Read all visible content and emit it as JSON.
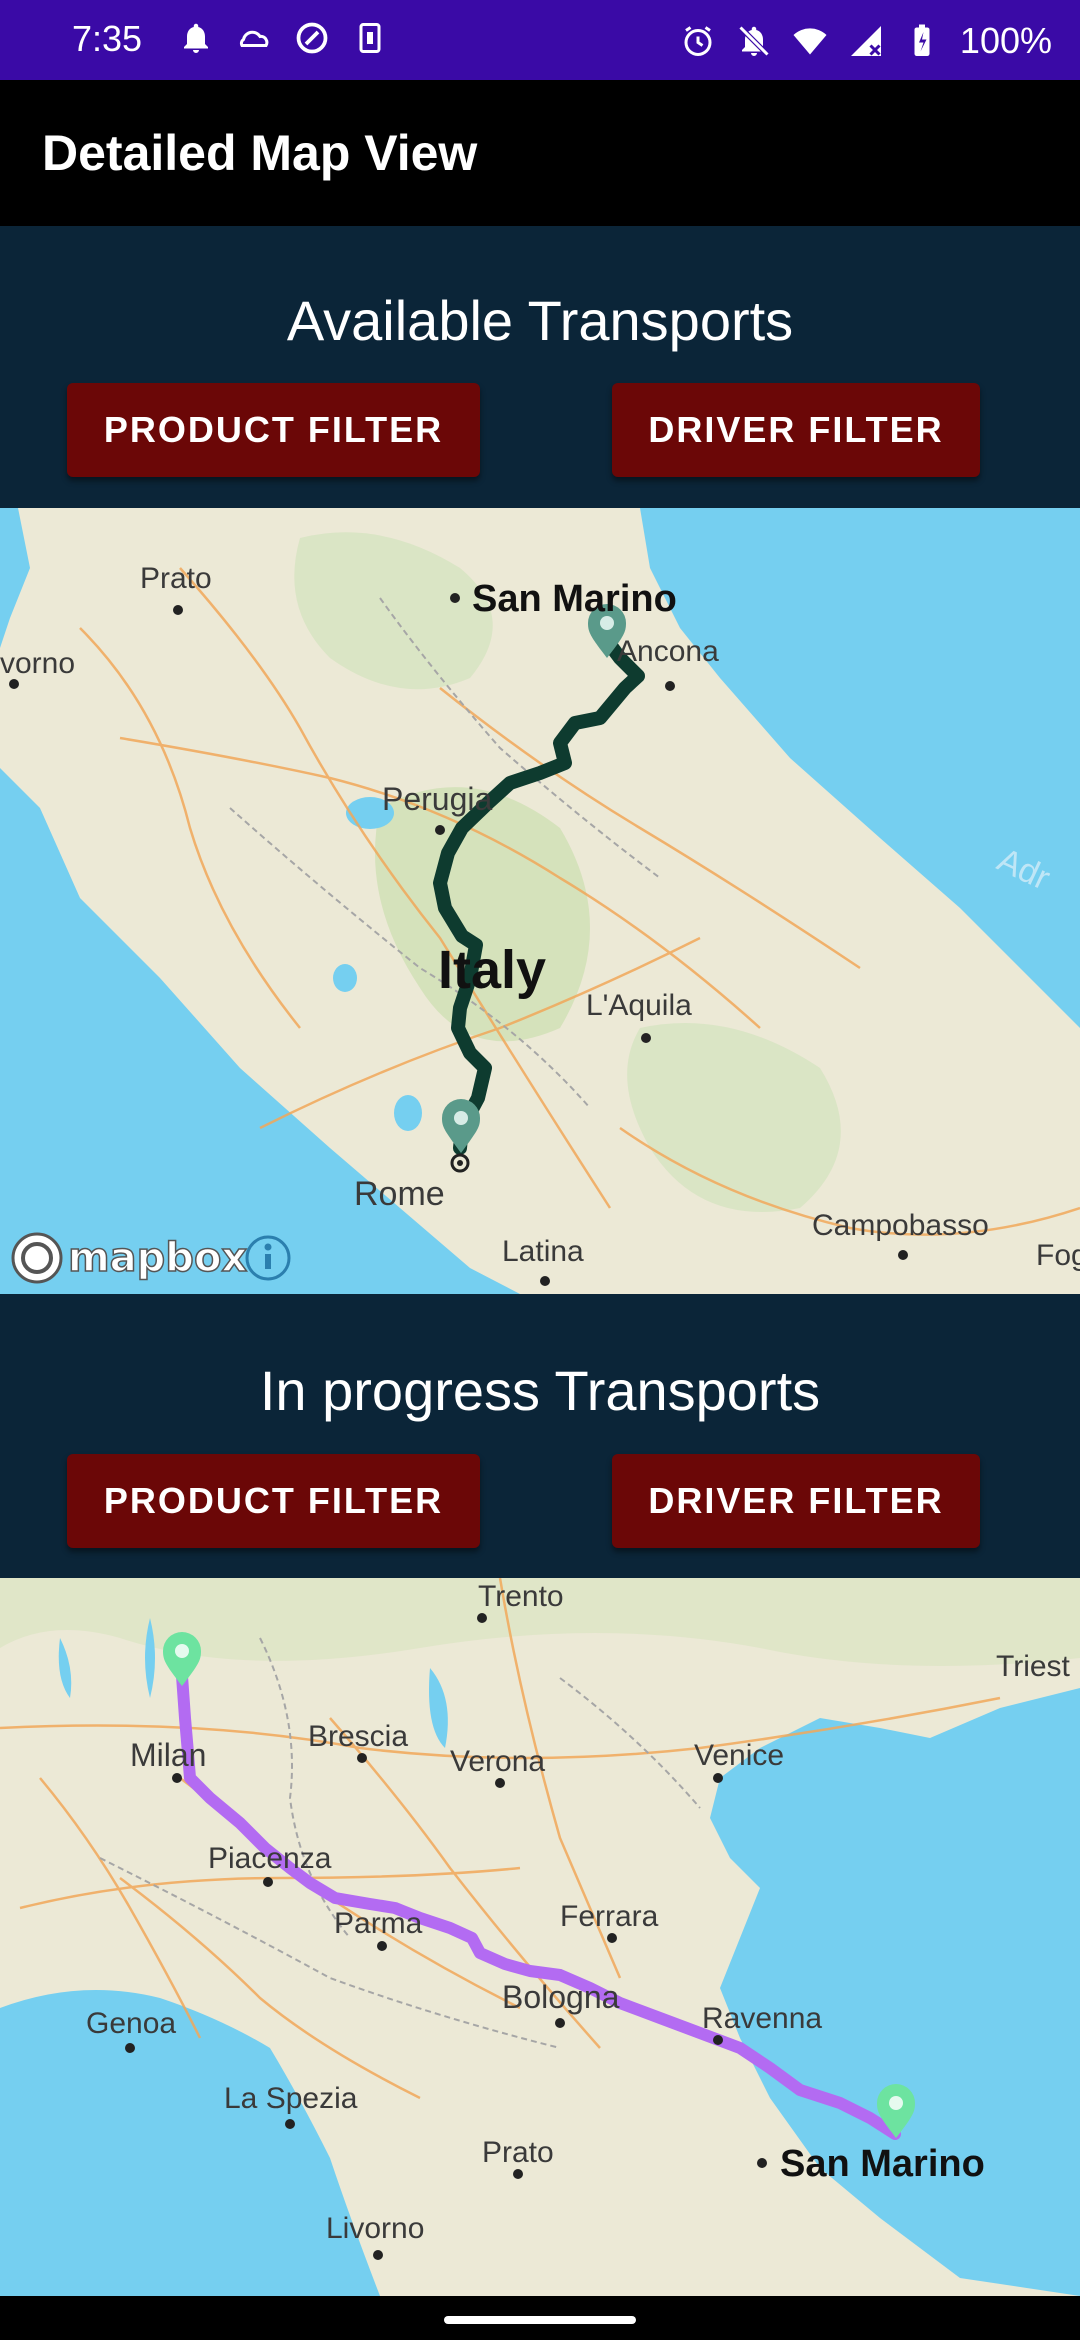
{
  "status_bar": {
    "time": "7:35",
    "battery": "100%",
    "left_icons": [
      "bell-icon",
      "cloud-icon",
      "sync-icon",
      "sim-icon"
    ],
    "right_icons": [
      "alarm-icon",
      "mute-icon",
      "wifi-icon",
      "signal-icon",
      "battery-icon"
    ]
  },
  "app_bar": {
    "title": "Detailed Map View"
  },
  "available": {
    "title": "Available Transports",
    "product_filter": "PRODUCT FILTER",
    "driver_filter": "DRIVER FILTER",
    "map": {
      "labels": {
        "prato": "Prato",
        "san_marino": "San Marino",
        "ancona": "Ancona",
        "livorno": "vorno",
        "perugia": "Perugia",
        "italy": "Italy",
        "laquila": "L'Aquila",
        "rome": "Rome",
        "latina": "Latina",
        "campobasso": "Campobasso",
        "foggia": "Fog",
        "adriatic": "Adr"
      },
      "attribution": "mapbox",
      "route_color": "#0e3b2f"
    }
  },
  "in_progress": {
    "title": "In progress Transports",
    "product_filter": "PRODUCT FILTER",
    "driver_filter": "DRIVER FILTER",
    "map": {
      "labels": {
        "trento": "Trento",
        "trieste": "Triest",
        "milan": "Milan",
        "brescia": "Brescia",
        "verona": "Verona",
        "venice": "Venice",
        "piacenza": "Piacenza",
        "parma": "Parma",
        "ferrara": "Ferrara",
        "bologna": "Bologna",
        "genoa": "Genoa",
        "ravenna": "Ravenna",
        "la_spezia": "La Spezia",
        "prato": "Prato",
        "san_marino": "San Marino",
        "livorno": "Livorno"
      },
      "route_color": "#b36bf2"
    }
  },
  "colors": {
    "status_bar": "#3a0aa6",
    "section_bg": "#0b2538",
    "button": "#6b0707",
    "land": "#ece9d6",
    "sea": "#75cff0"
  }
}
